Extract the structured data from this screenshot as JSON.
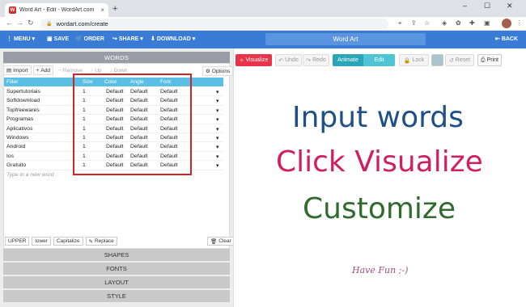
{
  "browser": {
    "tab_title": "Word Art - Edit - WordArt.com",
    "tab_close": "×",
    "new_tab": "+",
    "url": "wordart.com/create",
    "win_min": "–",
    "win_max": "☐",
    "win_close": "✕"
  },
  "app_toolbar": {
    "menu": "MENU",
    "save": "SAVE",
    "order": "ORDER",
    "share": "SHARE",
    "download": "DOWNLOAD",
    "title": "Word Art",
    "back": "BACK"
  },
  "left_panel": {
    "header": "WORDS",
    "toolbar": {
      "import": "Import",
      "add": "Add",
      "remove": "Remove",
      "up": "Up",
      "down": "Down",
      "options": "Options"
    },
    "columns": {
      "filter": "Filter",
      "size": "Size",
      "color": "Color",
      "angle": "Angle",
      "font": "Font"
    },
    "rows": [
      {
        "word": "Supertutoriais",
        "size": "1",
        "color": "Default",
        "angle": "Default",
        "font": "Default"
      },
      {
        "word": "Softdownload",
        "size": "1",
        "color": "Default",
        "angle": "Default",
        "font": "Default"
      },
      {
        "word": "Topfreewares",
        "size": "1",
        "color": "Default",
        "angle": "Default",
        "font": "Default"
      },
      {
        "word": "Programas",
        "size": "1",
        "color": "Default",
        "angle": "Default",
        "font": "Default"
      },
      {
        "word": "Aplicativos",
        "size": "1",
        "color": "Default",
        "angle": "Default",
        "font": "Default"
      },
      {
        "word": "Windows",
        "size": "1",
        "color": "Default",
        "angle": "Default",
        "font": "Default"
      },
      {
        "word": "Android",
        "size": "1",
        "color": "Default",
        "angle": "Default",
        "font": "Default"
      },
      {
        "word": "Ios",
        "size": "1",
        "color": "Default",
        "angle": "Default",
        "font": "Default"
      },
      {
        "word": "Gratuito",
        "size": "1",
        "color": "Default",
        "angle": "Default",
        "font": "Default"
      }
    ],
    "new_word_placeholder": "Type in a new word",
    "case_buttons": {
      "upper": "UPPER",
      "lower": "lower",
      "capitalize": "Capitalize",
      "replace": "Replace"
    },
    "clear": "Clear",
    "sections": [
      "SHAPES",
      "FONTS",
      "LAYOUT",
      "STYLE"
    ]
  },
  "right_panel": {
    "toolbar": {
      "visualize": "Visualize",
      "undo": "Undo",
      "redo": "Redo",
      "animate": "Animate",
      "edit": "Edit",
      "lock": "Lock",
      "reset": "Reset",
      "print": "Print"
    },
    "canvas_lines": [
      "Input words",
      "Click Visualize",
      "Customize",
      "Have Fun ;-)"
    ]
  },
  "colors": {
    "accent_blue": "#3a7bd5",
    "visualize_red": "#e8334a",
    "grid_header": "#5bbfe3",
    "highlight_box": "#d22424"
  }
}
